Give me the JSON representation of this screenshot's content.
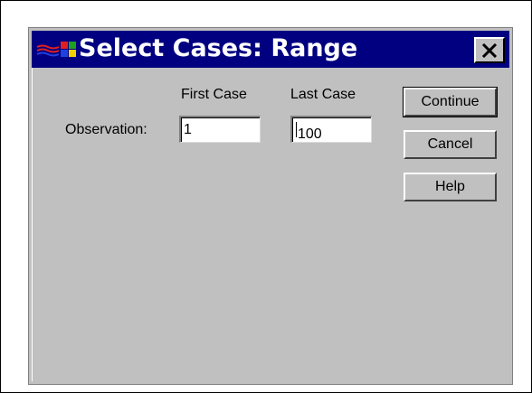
{
  "dialog": {
    "title": "Select Cases: Range",
    "close_symbol": "✕",
    "app_icon": "windows-logo-icon"
  },
  "range": {
    "row_label": "Observation:",
    "first_case_header": "First Case",
    "last_case_header": "Last Case",
    "first_case_value": "1",
    "last_case_value": "100"
  },
  "buttons": {
    "continue": "Continue",
    "cancel": "Cancel",
    "help": "Help"
  }
}
